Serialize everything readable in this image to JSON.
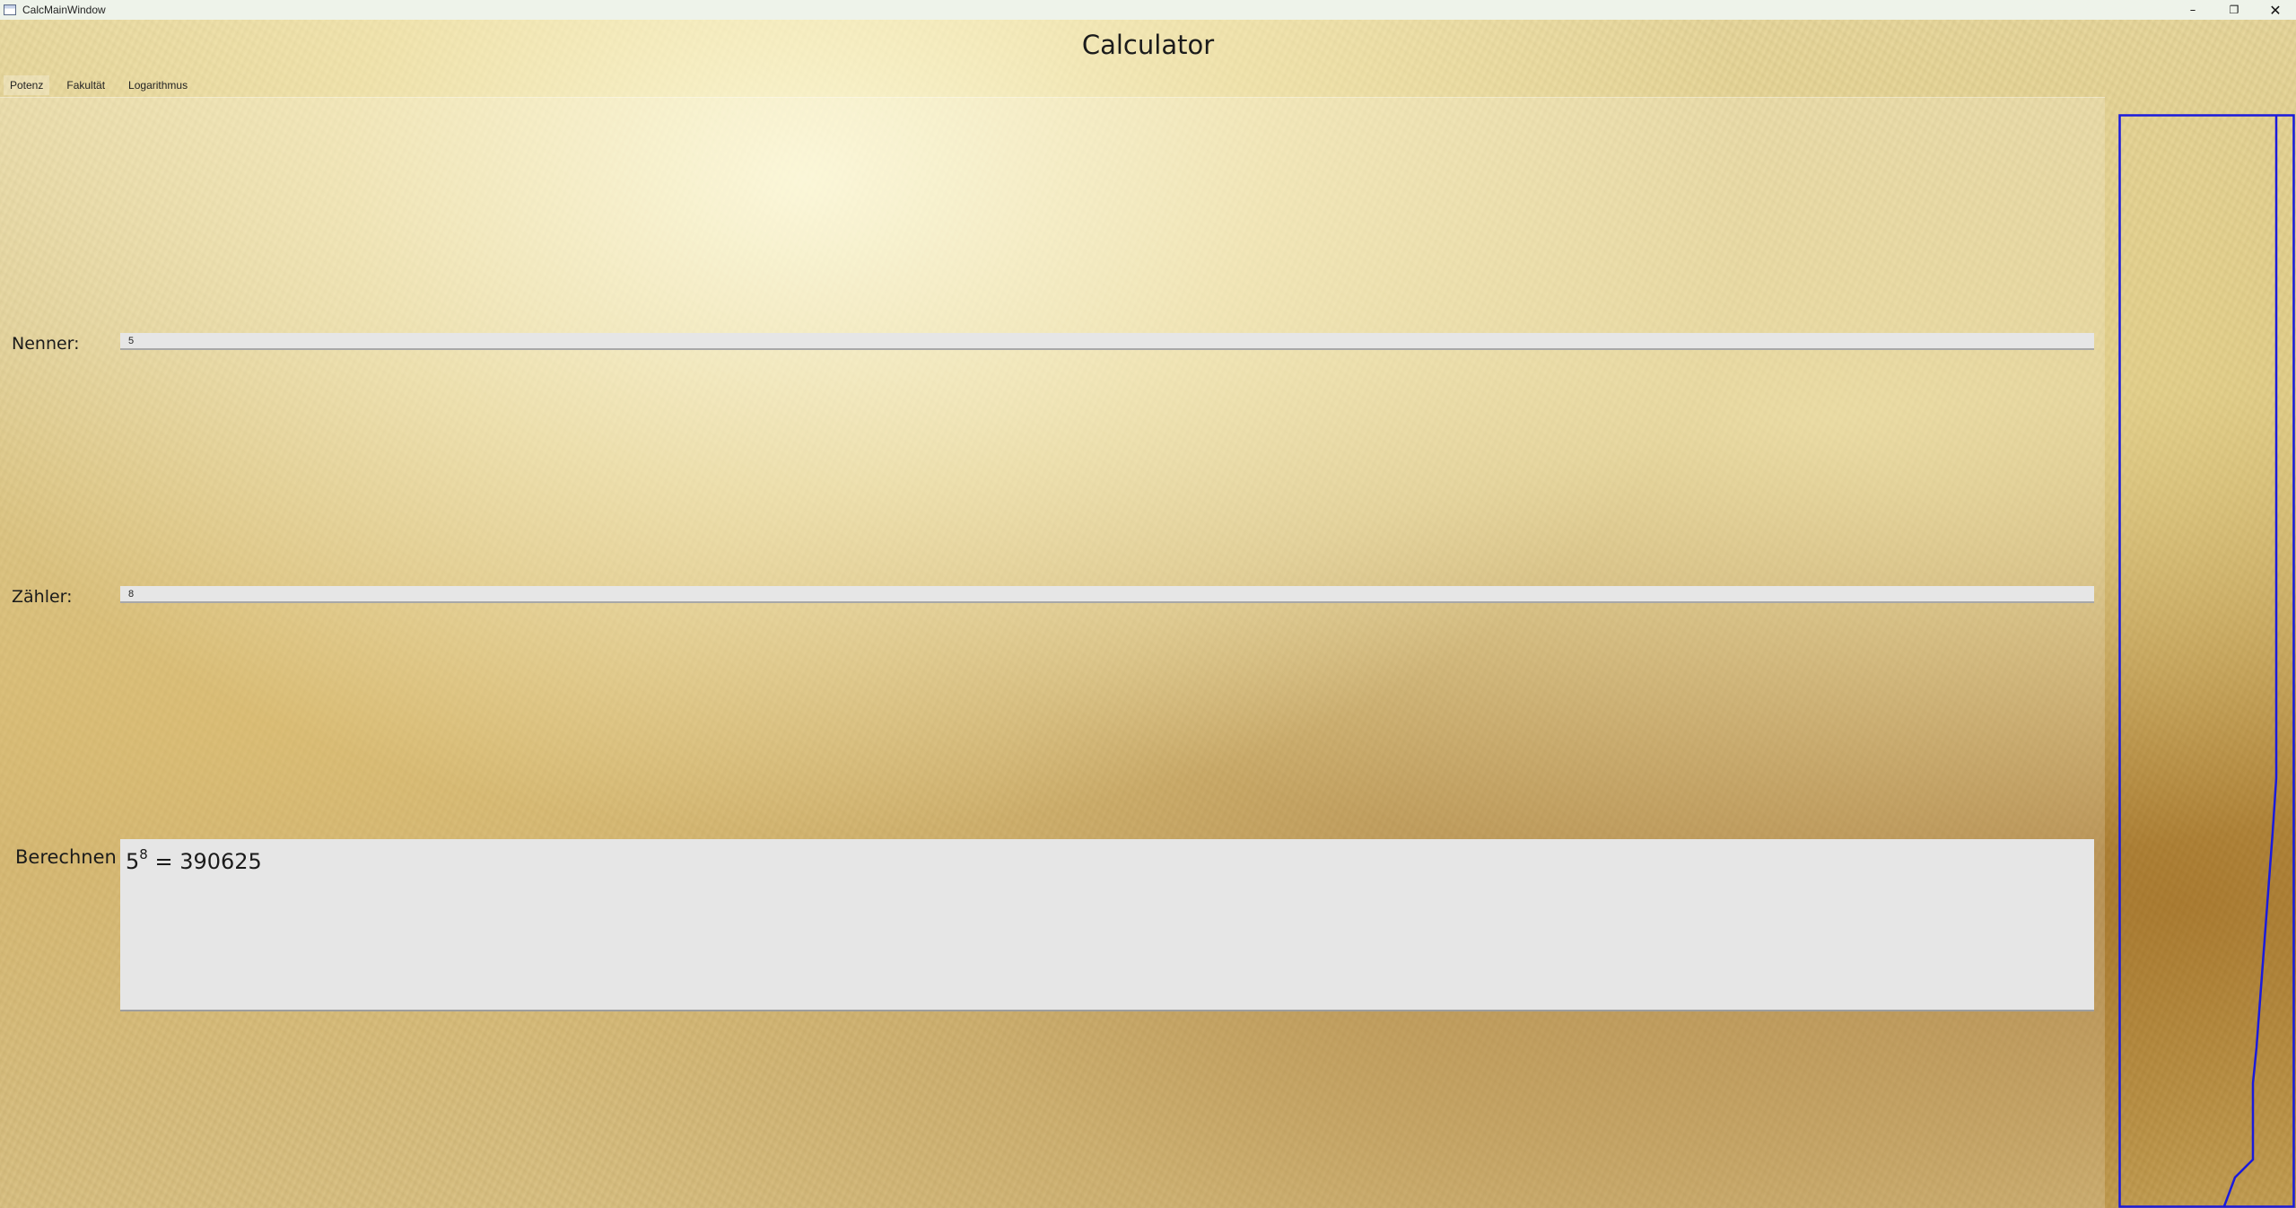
{
  "window": {
    "title": "CalcMainWindow",
    "controls": {
      "minimize_icon": "minimize-icon",
      "maximize_icon": "restore-icon",
      "close_icon": "close-icon"
    }
  },
  "app": {
    "heading": "Calculator"
  },
  "tabs": [
    {
      "label": "Potenz",
      "active": true
    },
    {
      "label": "Fakultät",
      "active": false
    },
    {
      "label": "Logarithmus",
      "active": false
    }
  ],
  "form": {
    "nenner_label": "Nenner:",
    "nenner_value": "5",
    "zaehler_label": "Zähler:",
    "zaehler_value": "8",
    "berechnen_label": "Berechnen",
    "result_base": "5",
    "result_exponent": "8",
    "result_tail": " = 390625"
  },
  "colors": {
    "plot_line": "#1a1adc",
    "input_bg": "#e6e6e6",
    "titlebar_bg": "#eef3ea"
  }
}
